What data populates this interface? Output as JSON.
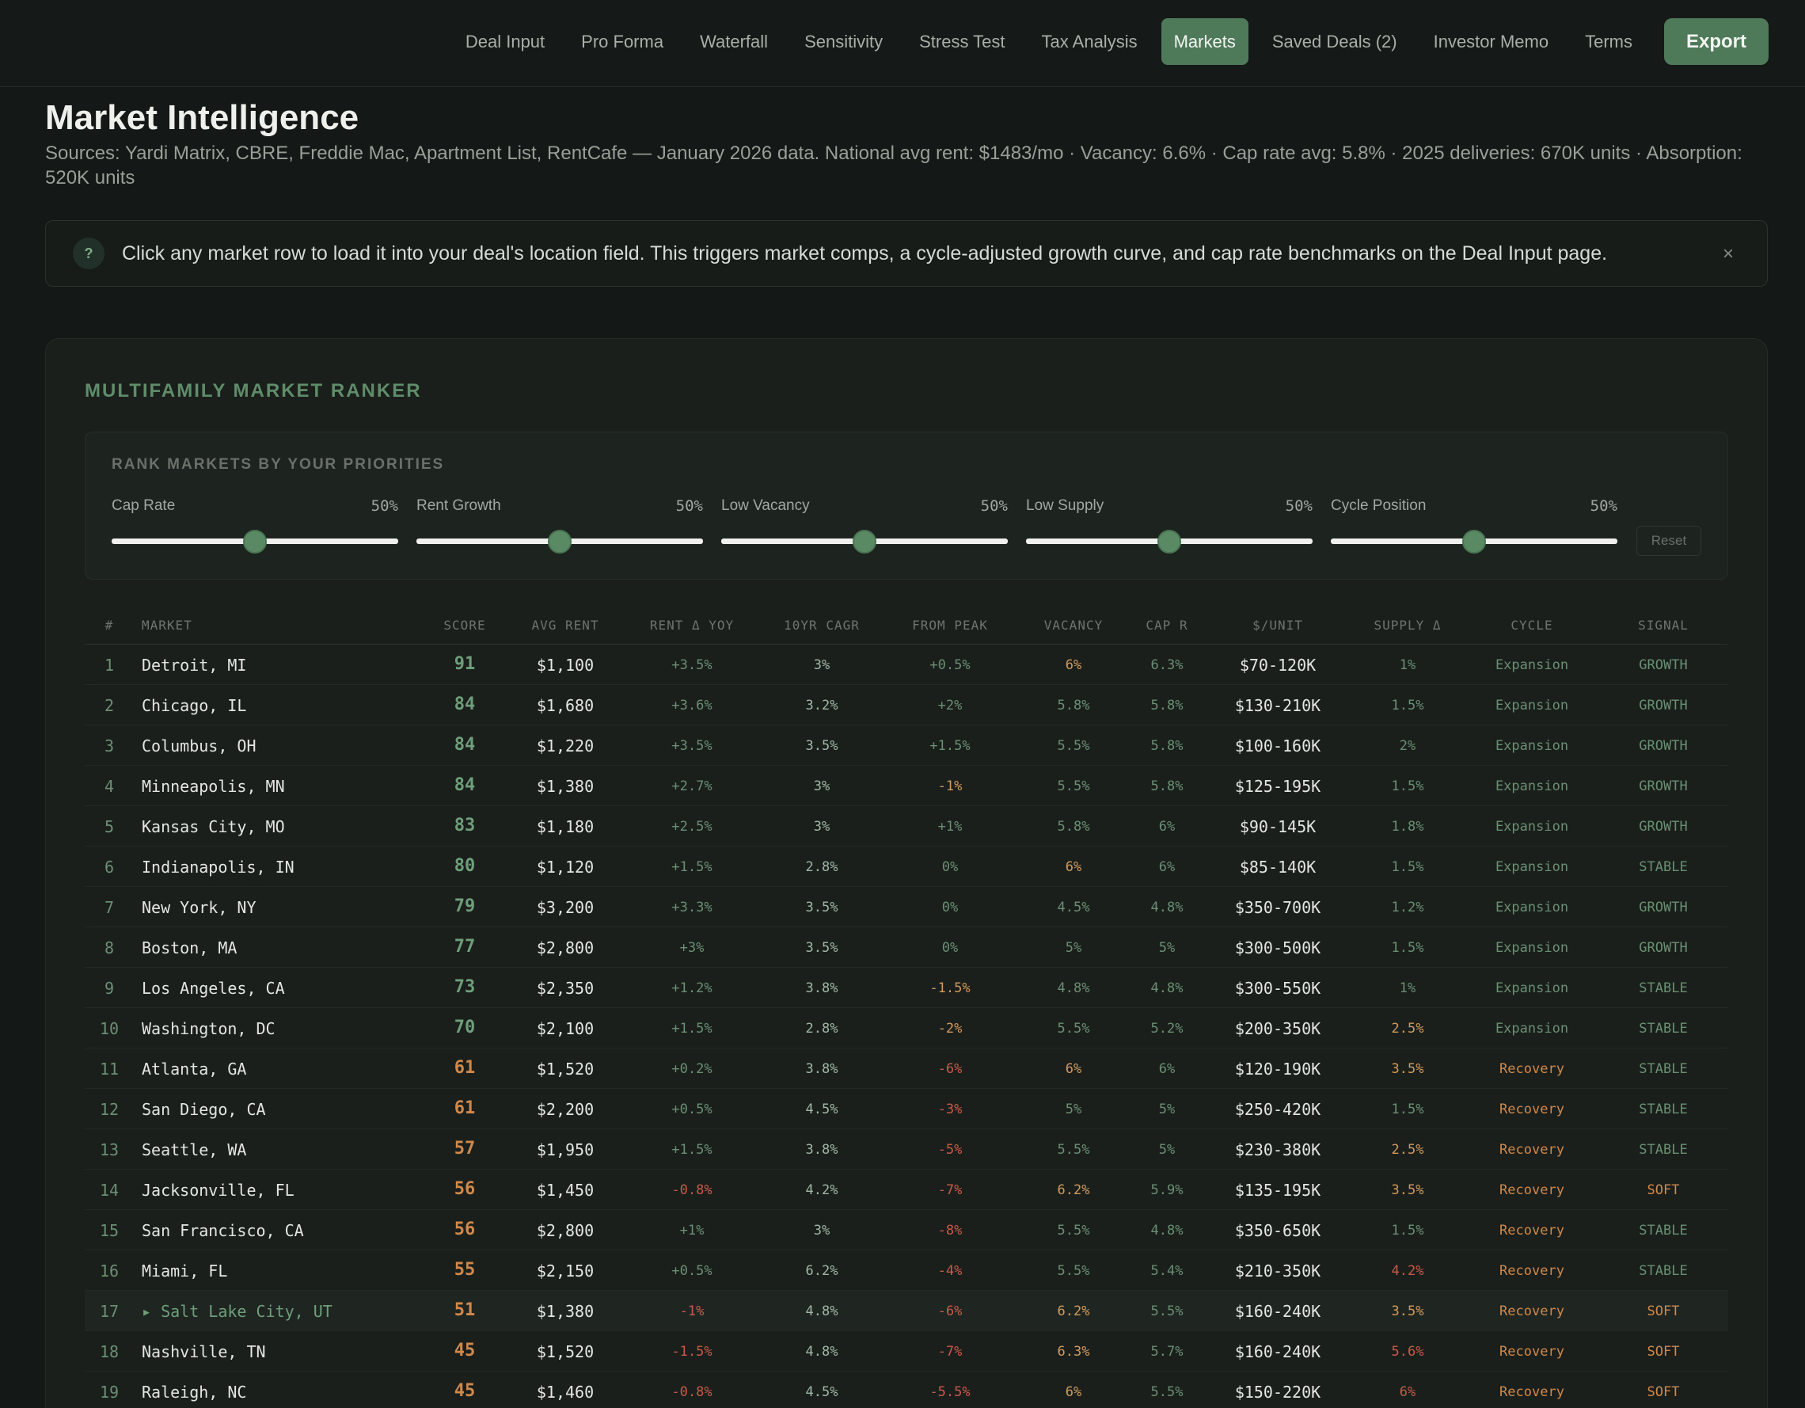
{
  "nav": {
    "tabs": [
      "Deal Input",
      "Pro Forma",
      "Waterfall",
      "Sensitivity",
      "Stress Test",
      "Tax Analysis",
      "Markets",
      "Saved Deals (2)",
      "Investor Memo",
      "Terms"
    ],
    "active": "Markets",
    "export_label": "Export"
  },
  "page": {
    "title": "Market Intelligence",
    "subtitle": "Sources: Yardi Matrix, CBRE, Freddie Mac, Apartment List, RentCafe — January 2026 data. National avg rent: $1483/mo · Vacancy: 6.6% · Cap rate avg: 5.8% · 2025 deliveries: 670K units · Absorption: 520K units"
  },
  "info": {
    "icon": "?",
    "text": "Click any market row to load it into your deal's location field. This triggers market comps, a cycle-adjusted growth curve, and cap rate benchmarks on the Deal Input page.",
    "close": "×"
  },
  "panel": {
    "title": "MULTIFAMILY MARKET RANKER",
    "priorities_title": "RANK MARKETS BY YOUR PRIORITIES",
    "reset_label": "Reset",
    "sliders": [
      {
        "label": "Cap Rate",
        "value": "50%",
        "level": 0.5
      },
      {
        "label": "Rent Growth",
        "value": "50%",
        "level": 0.5
      },
      {
        "label": "Low Vacancy",
        "value": "50%",
        "level": 0.5
      },
      {
        "label": "Low Supply",
        "value": "50%",
        "level": 0.5
      },
      {
        "label": "Cycle Position",
        "value": "50%",
        "level": 0.5
      }
    ]
  },
  "colors": {
    "green": "#6f9f7a",
    "amber": "#d0894a",
    "red": "#c75a4a",
    "orange": "#d29a5c",
    "muted_green": "#6a8f72"
  },
  "table": {
    "headers": [
      "#",
      "MARKET",
      "SCORE",
      "AVG RENT",
      "RENT Δ YOY",
      "10YR CAGR",
      "FROM PEAK",
      "VACANCY",
      "CAP R",
      "$/UNIT",
      "SUPPLY Δ",
      "CYCLE",
      "SIGNAL"
    ],
    "rows": [
      {
        "rank": "1",
        "market": "Detroit, MI",
        "score": "91",
        "rent": "$1,100",
        "yoy": "+3.5%",
        "cagr": "3%",
        "peak": "+0.5%",
        "vac": "6%",
        "cap": "6.3%",
        "unit": "$70-120K",
        "supply": "1%",
        "cycle": "Expansion",
        "signal": "GROWTH"
      },
      {
        "rank": "2",
        "market": "Chicago, IL",
        "score": "84",
        "rent": "$1,680",
        "yoy": "+3.6%",
        "cagr": "3.2%",
        "peak": "+2%",
        "vac": "5.8%",
        "cap": "5.8%",
        "unit": "$130-210K",
        "supply": "1.5%",
        "cycle": "Expansion",
        "signal": "GROWTH"
      },
      {
        "rank": "3",
        "market": "Columbus, OH",
        "score": "84",
        "rent": "$1,220",
        "yoy": "+3.5%",
        "cagr": "3.5%",
        "peak": "+1.5%",
        "vac": "5.5%",
        "cap": "5.8%",
        "unit": "$100-160K",
        "supply": "2%",
        "cycle": "Expansion",
        "signal": "GROWTH"
      },
      {
        "rank": "4",
        "market": "Minneapolis, MN",
        "score": "84",
        "rent": "$1,380",
        "yoy": "+2.7%",
        "cagr": "3%",
        "peak": "-1%",
        "vac": "5.5%",
        "cap": "5.8%",
        "unit": "$125-195K",
        "supply": "1.5%",
        "cycle": "Expansion",
        "signal": "GROWTH"
      },
      {
        "rank": "5",
        "market": "Kansas City, MO",
        "score": "83",
        "rent": "$1,180",
        "yoy": "+2.5%",
        "cagr": "3%",
        "peak": "+1%",
        "vac": "5.8%",
        "cap": "6%",
        "unit": "$90-145K",
        "supply": "1.8%",
        "cycle": "Expansion",
        "signal": "GROWTH"
      },
      {
        "rank": "6",
        "market": "Indianapolis, IN",
        "score": "80",
        "rent": "$1,120",
        "yoy": "+1.5%",
        "cagr": "2.8%",
        "peak": "0%",
        "vac": "6%",
        "cap": "6%",
        "unit": "$85-140K",
        "supply": "1.5%",
        "cycle": "Expansion",
        "signal": "STABLE"
      },
      {
        "rank": "7",
        "market": "New York, NY",
        "score": "79",
        "rent": "$3,200",
        "yoy": "+3.3%",
        "cagr": "3.5%",
        "peak": "0%",
        "vac": "4.5%",
        "cap": "4.8%",
        "unit": "$350-700K",
        "supply": "1.2%",
        "cycle": "Expansion",
        "signal": "GROWTH"
      },
      {
        "rank": "8",
        "market": "Boston, MA",
        "score": "77",
        "rent": "$2,800",
        "yoy": "+3%",
        "cagr": "3.5%",
        "peak": "0%",
        "vac": "5%",
        "cap": "5%",
        "unit": "$300-500K",
        "supply": "1.5%",
        "cycle": "Expansion",
        "signal": "GROWTH"
      },
      {
        "rank": "9",
        "market": "Los Angeles, CA",
        "score": "73",
        "rent": "$2,350",
        "yoy": "+1.2%",
        "cagr": "3.8%",
        "peak": "-1.5%",
        "vac": "4.8%",
        "cap": "4.8%",
        "unit": "$300-550K",
        "supply": "1%",
        "cycle": "Expansion",
        "signal": "STABLE"
      },
      {
        "rank": "10",
        "market": "Washington, DC",
        "score": "70",
        "rent": "$2,100",
        "yoy": "+1.5%",
        "cagr": "2.8%",
        "peak": "-2%",
        "vac": "5.5%",
        "cap": "5.2%",
        "unit": "$200-350K",
        "supply": "2.5%",
        "cycle": "Expansion",
        "signal": "STABLE"
      },
      {
        "rank": "11",
        "market": "Atlanta, GA",
        "score": "61",
        "rent": "$1,520",
        "yoy": "+0.2%",
        "cagr": "3.8%",
        "peak": "-6%",
        "vac": "6%",
        "cap": "6%",
        "unit": "$120-190K",
        "supply": "3.5%",
        "cycle": "Recovery",
        "signal": "STABLE"
      },
      {
        "rank": "12",
        "market": "San Diego, CA",
        "score": "61",
        "rent": "$2,200",
        "yoy": "+0.5%",
        "cagr": "4.5%",
        "peak": "-3%",
        "vac": "5%",
        "cap": "5%",
        "unit": "$250-420K",
        "supply": "1.5%",
        "cycle": "Recovery",
        "signal": "STABLE"
      },
      {
        "rank": "13",
        "market": "Seattle, WA",
        "score": "57",
        "rent": "$1,950",
        "yoy": "+1.5%",
        "cagr": "3.8%",
        "peak": "-5%",
        "vac": "5.5%",
        "cap": "5%",
        "unit": "$230-380K",
        "supply": "2.5%",
        "cycle": "Recovery",
        "signal": "STABLE"
      },
      {
        "rank": "14",
        "market": "Jacksonville, FL",
        "score": "56",
        "rent": "$1,450",
        "yoy": "-0.8%",
        "cagr": "4.2%",
        "peak": "-7%",
        "vac": "6.2%",
        "cap": "5.9%",
        "unit": "$135-195K",
        "supply": "3.5%",
        "cycle": "Recovery",
        "signal": "SOFT"
      },
      {
        "rank": "15",
        "market": "San Francisco, CA",
        "score": "56",
        "rent": "$2,800",
        "yoy": "+1%",
        "cagr": "3%",
        "peak": "-8%",
        "vac": "5.5%",
        "cap": "4.8%",
        "unit": "$350-650K",
        "supply": "1.5%",
        "cycle": "Recovery",
        "signal": "STABLE"
      },
      {
        "rank": "16",
        "market": "Miami, FL",
        "score": "55",
        "rent": "$2,150",
        "yoy": "+0.5%",
        "cagr": "6.2%",
        "peak": "-4%",
        "vac": "5.5%",
        "cap": "5.4%",
        "unit": "$210-350K",
        "supply": "4.2%",
        "cycle": "Recovery",
        "signal": "STABLE"
      },
      {
        "rank": "17",
        "market": "▸ Salt Lake City, UT",
        "score": "51",
        "rent": "$1,380",
        "yoy": "-1%",
        "cagr": "4.8%",
        "peak": "-6%",
        "vac": "6.2%",
        "cap": "5.5%",
        "unit": "$160-240K",
        "supply": "3.5%",
        "cycle": "Recovery",
        "signal": "SOFT",
        "highlight": true
      },
      {
        "rank": "18",
        "market": "Nashville, TN",
        "score": "45",
        "rent": "$1,520",
        "yoy": "-1.5%",
        "cagr": "4.8%",
        "peak": "-7%",
        "vac": "6.3%",
        "cap": "5.7%",
        "unit": "$160-240K",
        "supply": "5.6%",
        "cycle": "Recovery",
        "signal": "SOFT"
      },
      {
        "rank": "19",
        "market": "Raleigh, NC",
        "score": "45",
        "rent": "$1,460",
        "yoy": "-0.8%",
        "cagr": "4.5%",
        "peak": "-5.5%",
        "vac": "6%",
        "cap": "5.5%",
        "unit": "$150-220K",
        "supply": "6%",
        "cycle": "Recovery",
        "signal": "SOFT"
      }
    ]
  }
}
